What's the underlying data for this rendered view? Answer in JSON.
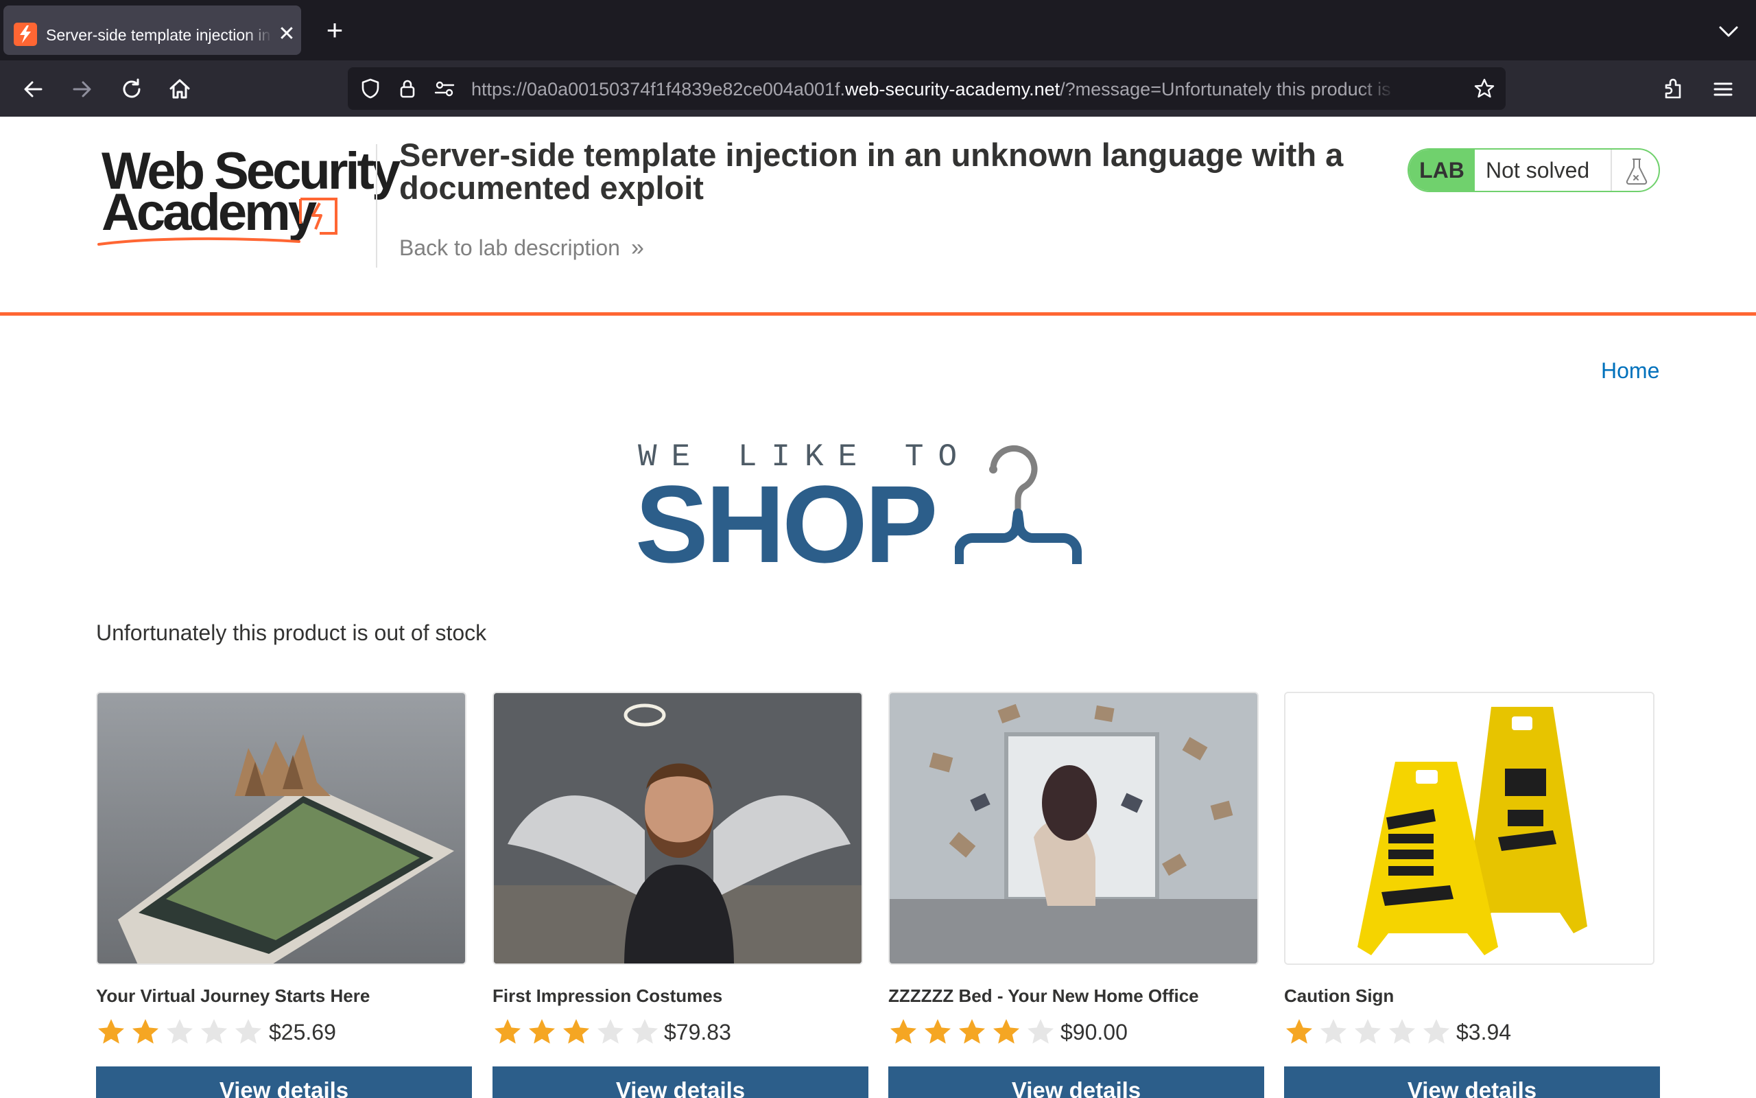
{
  "browser": {
    "tab_title": "Server-side template injection in an unknown language with a documented exploit",
    "tab_close": "✕",
    "new_tab": "+",
    "url_prefix": "https://0a0a00150374f1f4839e82ce004a001f.",
    "url_domain": "web-security-academy.net",
    "url_suffix": "/?message=Unfortunately this product is out of stock",
    "theme_colors": {
      "tabbar": "#1c1b22",
      "toolbar": "#2b2a33",
      "active_tab": "#42414d"
    }
  },
  "lab": {
    "logo_line1": "Web Security",
    "logo_line2": "Academy",
    "title": "Server-side template injection in an unknown language with a documented exploit",
    "back_link": "Back to lab description",
    "badge": "LAB",
    "status": "Not solved",
    "accent_color": "#ff6633",
    "status_color": "#70d16d"
  },
  "shop": {
    "home_link": "Home",
    "banner_small": "WE LIKE TO",
    "banner_big": "SHOP",
    "message": "Unfortunately this product is out of stock",
    "brand_color": "#2c5e8a",
    "products": [
      {
        "name": "Your Virtual Journey Starts Here",
        "rating": 2,
        "price": "$25.69",
        "button": "View details"
      },
      {
        "name": "First Impression Costumes",
        "rating": 3,
        "price": "$79.83",
        "button": "View details"
      },
      {
        "name": "ZZZZZZ Bed - Your New Home Office",
        "rating": 4,
        "price": "$90.00",
        "button": "View details"
      },
      {
        "name": "Caution Sign",
        "rating": 1,
        "price": "$3.94",
        "button": "View details"
      }
    ]
  }
}
